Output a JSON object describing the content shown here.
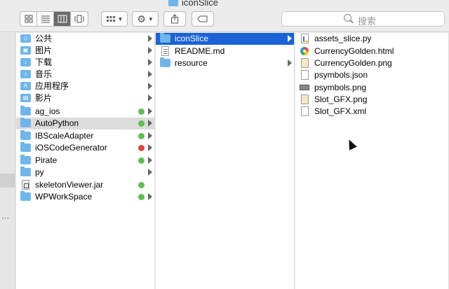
{
  "window": {
    "title": "iconSlice"
  },
  "toolbar": {
    "view_icon": "icon-view-icon",
    "view_list": "list-view-icon",
    "view_column": "column-view-icon",
    "view_cover": "coverflow-view-icon",
    "arrange": "arrange-icon",
    "action": "gear-icon",
    "share": "share-icon",
    "tag": "tag-icon",
    "search_placeholder": "搜索"
  },
  "colors": {
    "selection": "#1b62d6",
    "highlight": "#dcdcdc",
    "green_tag": "#5ac24a",
    "red_tag": "#e0453a",
    "folder": "#6fb6ec"
  },
  "column1": [
    {
      "label": "公共",
      "icon": "public-folder-icon",
      "arrow": true
    },
    {
      "label": "图片",
      "icon": "pictures-folder-icon",
      "arrow": true
    },
    {
      "label": "下载",
      "icon": "downloads-folder-icon",
      "arrow": true
    },
    {
      "label": "音乐",
      "icon": "music-folder-icon",
      "arrow": true
    },
    {
      "label": "应用程序",
      "icon": "applications-folder-icon",
      "arrow": true
    },
    {
      "label": "影片",
      "icon": "movies-folder-icon",
      "arrow": true
    },
    {
      "label": "ag_ios",
      "icon": "folder-icon",
      "arrow": true,
      "tag": "green"
    },
    {
      "label": "AutoPython",
      "icon": "folder-icon",
      "arrow": true,
      "tag": "green",
      "state": "highlighted"
    },
    {
      "label": "IBScaleAdapter",
      "icon": "folder-icon",
      "arrow": true,
      "tag": "green"
    },
    {
      "label": "iOSCodeGenerator",
      "icon": "folder-icon",
      "arrow": true,
      "tag": "red"
    },
    {
      "label": "Pirate",
      "icon": "folder-icon",
      "arrow": true,
      "tag": "green"
    },
    {
      "label": "py",
      "icon": "folder-icon",
      "arrow": true
    },
    {
      "label": "skeletonViewer.jar",
      "icon": "jar-file-icon",
      "arrow": false,
      "tag": "green"
    },
    {
      "label": "WPWorkSpace",
      "icon": "folder-icon",
      "arrow": true,
      "tag": "green"
    }
  ],
  "column2": [
    {
      "label": "iconSlice",
      "icon": "folder-icon",
      "arrow": true,
      "state": "selected"
    },
    {
      "label": "README.md",
      "icon": "text-file-icon",
      "arrow": false
    },
    {
      "label": "resource",
      "icon": "folder-icon",
      "arrow": true
    }
  ],
  "column3": [
    {
      "label": "assets_slice.py",
      "icon": "python-file-icon"
    },
    {
      "label": "CurrencyGolden.html",
      "icon": "html-file-icon"
    },
    {
      "label": "CurrencyGolden.png",
      "icon": "png-file-icon"
    },
    {
      "label": "psymbols.json",
      "icon": "json-file-icon"
    },
    {
      "label": "psymbols.png",
      "icon": "png-file-icon"
    },
    {
      "label": "Slot_GFX.png",
      "icon": "png-file-icon"
    },
    {
      "label": "Slot_GFX.xml",
      "icon": "xml-file-icon"
    }
  ]
}
